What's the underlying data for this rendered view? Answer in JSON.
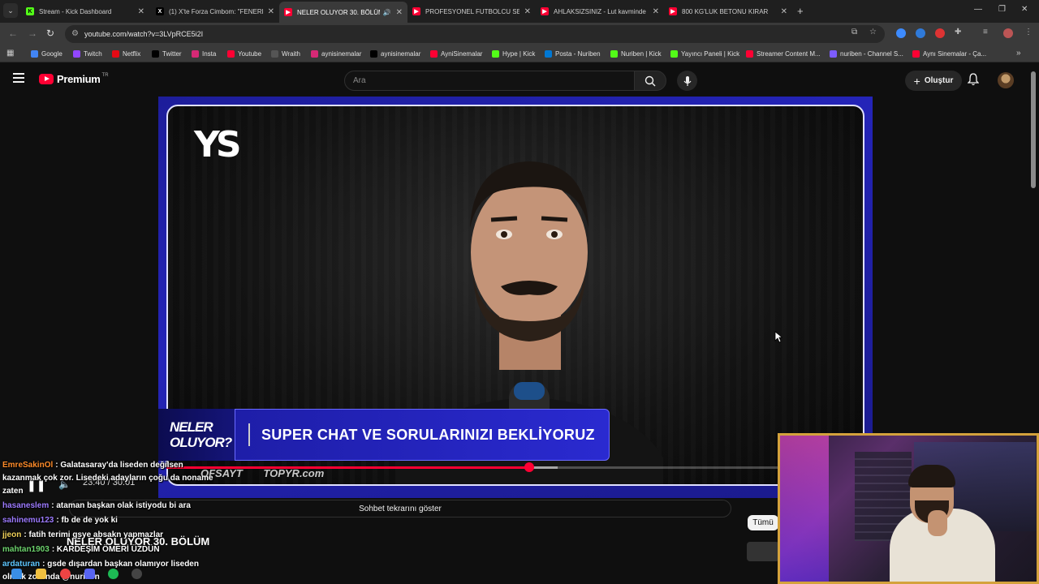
{
  "browser": {
    "tabs": [
      {
        "label": "Stream - Kick Dashboard",
        "favicon": "kick-icon",
        "color": "#53fc18"
      },
      {
        "label": "(1) X'te Forza Cimbom: \"FENERB",
        "favicon": "x-icon",
        "color": "#000000"
      },
      {
        "label": "NELER OLUYOR 30. BÖLÜM",
        "favicon": "youtube-icon",
        "color": "#ff0033",
        "active": true
      },
      {
        "label": "PROFESYONEL FUTBOLCU SEN",
        "favicon": "youtube-icon",
        "color": "#ff0033"
      },
      {
        "label": "AHLAKSIZSINIZ - Lut kavminde",
        "favicon": "youtube-icon",
        "color": "#ff0033"
      },
      {
        "label": "800 KG'LUK BETONU KIRAR",
        "favicon": "youtube-icon",
        "color": "#ff0033"
      }
    ],
    "url": "youtube.com/watch?v=3LVpRCE5i2I",
    "bookmarks": [
      {
        "label": "Google",
        "icon": "google-icon",
        "color": "#4285f4"
      },
      {
        "label": "Twitch",
        "icon": "twitch-icon",
        "color": "#9146ff"
      },
      {
        "label": "Netflix",
        "icon": "netflix-icon",
        "color": "#e50914"
      },
      {
        "label": "Twitter",
        "icon": "x-icon",
        "color": "#000000"
      },
      {
        "label": "Insta",
        "icon": "instagram-icon",
        "color": "#d62976"
      },
      {
        "label": "Youtube",
        "icon": "youtube-icon",
        "color": "#ff0033"
      },
      {
        "label": "Wraith",
        "icon": "wraith-icon",
        "color": "#555555"
      },
      {
        "label": "aynisinemalar",
        "icon": "instagram-icon",
        "color": "#d62976"
      },
      {
        "label": "aynisinemalar",
        "icon": "x-icon",
        "color": "#000000"
      },
      {
        "label": "AyniSinemalar",
        "icon": "youtube-icon",
        "color": "#ff0033"
      },
      {
        "label": "Hype | Kick",
        "icon": "kick-icon",
        "color": "#53fc18"
      },
      {
        "label": "Posta - Nuriben",
        "icon": "outlook-icon",
        "color": "#0078d4"
      },
      {
        "label": "Nuriben | Kick",
        "icon": "kick-icon",
        "color": "#53fc18"
      },
      {
        "label": "Yayıncı Paneli | Kick",
        "icon": "kick-icon",
        "color": "#53fc18"
      },
      {
        "label": "Streamer Content M...",
        "icon": "youtube-icon",
        "color": "#ff0033"
      },
      {
        "label": "nuriben - Channel S...",
        "icon": "channel-icon",
        "color": "#7c5cff"
      },
      {
        "label": "Aynı Sinemalar - Ça...",
        "icon": "youtube-icon",
        "color": "#ff0033"
      }
    ]
  },
  "youtube": {
    "brand": "Premium",
    "country": "TR",
    "search_placeholder": "Ara",
    "create_label": "Oluştur",
    "chat_replay_label": "Sohbet tekrarını göster",
    "chip_all": "Tümü",
    "video_title": "NELER OLUYOR 30. BÖLÜM",
    "timecode": "23:40 / 30:01",
    "progress_fraction": 0.52,
    "buffer_fraction": 0.56
  },
  "video_overlay": {
    "channel_logo": "YS",
    "show_logo_line1": "NELER",
    "show_logo_line2": "OLUYOR?",
    "lower_third_text": "SUPER CHAT VE SORULARINIZI BEKLİYORUZ",
    "sponsor1": "OFSAYT",
    "sponsor2": "TOPYR.com"
  },
  "chat": [
    {
      "user": "EmreSakinOl",
      "color": "#ff8c2a",
      "text": "Galatasaray'da liseden değilsen kazanmak çok zor. Lisedeki adayların çoğu da noname zaten"
    },
    {
      "user": "hasaneslem",
      "color": "#9d7bff",
      "text": "ataman başkan olak istiyodu bi ara"
    },
    {
      "user": "sahinemu123",
      "color": "#9d7bff",
      "text": "fb de de yok ki"
    },
    {
      "user": "jjeon",
      "color": "#f0d15a",
      "text": "fatih terimi gsye absakn yapmazlar"
    },
    {
      "user": "mahtan1903",
      "color": "#6ed46e",
      "text": "KARDEŞİM ÖMERİ ÜZDÜN"
    },
    {
      "user": "ardaturan",
      "color": "#5fc7ff",
      "text": "gsde dışardan başkan olamıyor liseden olmak zorunda @nuriben"
    }
  ],
  "colors": {
    "yt_red": "#ff0033",
    "facecam_border": "#d4a23c",
    "overlay_blue": "#2424b8"
  }
}
